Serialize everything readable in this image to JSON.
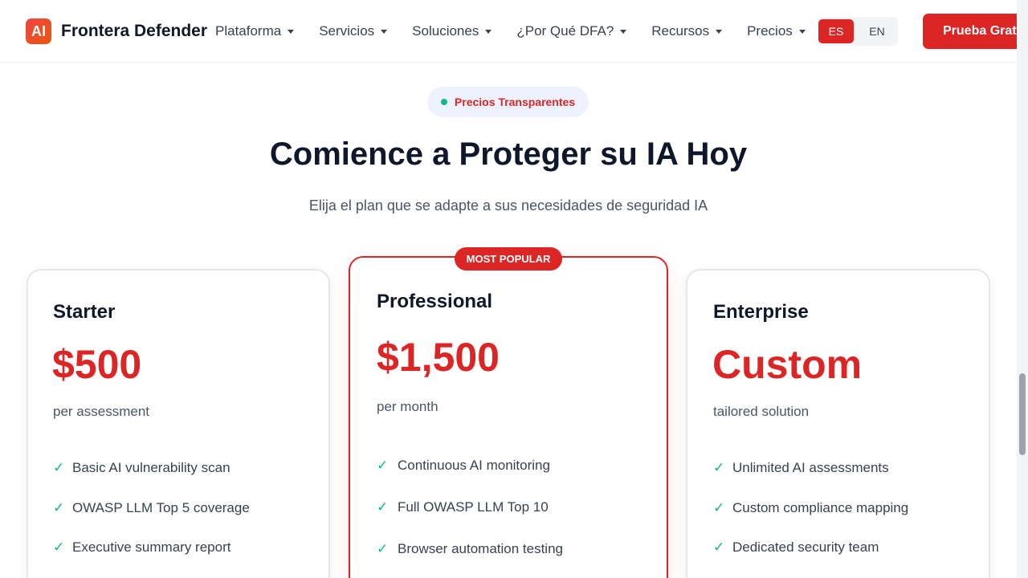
{
  "header": {
    "logo_text": "AI",
    "brand": "Frontera Defender",
    "nav": [
      "Plataforma",
      "Servicios",
      "Soluciones",
      "¿Por Qué DFA?",
      "Recursos",
      "Precios"
    ],
    "lang_es": "ES",
    "lang_en": "EN",
    "cta": "Prueba Gratis"
  },
  "hero": {
    "pill": "Precios Transparentes",
    "title": "Comience a Proteger su IA Hoy",
    "subtitle": "Elija el plan que se adapte a sus necesidades de seguridad IA"
  },
  "plans": [
    {
      "name": "Starter",
      "price": "$500",
      "period": "per assessment",
      "features": [
        "Basic AI vulnerability scan",
        "OWASP LLM Top 5 coverage",
        "Executive summary report"
      ]
    },
    {
      "badge": "MOST POPULAR",
      "name": "Professional",
      "price": "$1,500",
      "period": "per month",
      "features": [
        "Continuous AI monitoring",
        "Full OWASP LLM Top 10",
        "Browser automation testing"
      ]
    },
    {
      "name": "Enterprise",
      "price": "Custom",
      "period": "tailored solution",
      "features": [
        "Unlimited AI assessments",
        "Custom compliance mapping",
        "Dedicated security team"
      ]
    }
  ],
  "colors": {
    "accent": "#dc2626",
    "check": "#10b981",
    "text_dark": "#0f172a",
    "text_muted": "#4b5563"
  },
  "icons": {
    "check": "checkmark-icon",
    "caret": "chevron-down-icon"
  }
}
